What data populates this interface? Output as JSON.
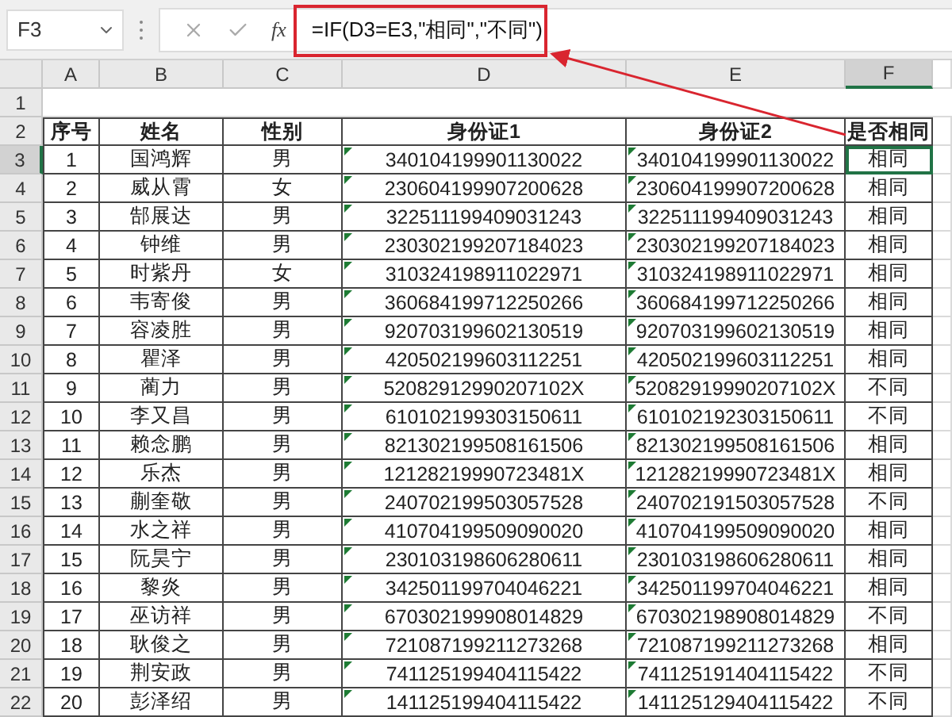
{
  "name_box": "F3",
  "function_label": "fx",
  "formula": "=IF(D3=E3,\"相同\",\"不同\")",
  "columns": [
    {
      "label": "A",
      "selected": false
    },
    {
      "label": "B",
      "selected": false
    },
    {
      "label": "C",
      "selected": false
    },
    {
      "label": "D",
      "selected": false
    },
    {
      "label": "E",
      "selected": false
    },
    {
      "label": "F",
      "selected": true
    }
  ],
  "empty_row": {
    "number": "1"
  },
  "header_row": {
    "number": "2",
    "cells": [
      "序号",
      "姓名",
      "性别",
      "身份证1",
      "身份证2",
      "是否相同"
    ]
  },
  "rows": [
    {
      "number": "3",
      "selected": true,
      "cells": [
        "1",
        "国鸿辉",
        "男",
        "340104199901130022",
        "340104199901130022",
        "相同"
      ]
    },
    {
      "number": "4",
      "selected": false,
      "cells": [
        "2",
        "威从霄",
        "女",
        "230604199907200628",
        "230604199907200628",
        "相同"
      ]
    },
    {
      "number": "5",
      "selected": false,
      "cells": [
        "3",
        "郜展达",
        "男",
        "322511199409031243",
        "322511199409031243",
        "相同"
      ]
    },
    {
      "number": "6",
      "selected": false,
      "cells": [
        "4",
        "钟维",
        "男",
        "230302199207184023",
        "230302199207184023",
        "相同"
      ]
    },
    {
      "number": "7",
      "selected": false,
      "cells": [
        "5",
        "时紫丹",
        "女",
        "310324198911022971",
        "310324198911022971",
        "相同"
      ]
    },
    {
      "number": "8",
      "selected": false,
      "cells": [
        "6",
        "韦寄俊",
        "男",
        "360684199712250266",
        "360684199712250266",
        "相同"
      ]
    },
    {
      "number": "9",
      "selected": false,
      "cells": [
        "7",
        "容凌胜",
        "男",
        "920703199602130519",
        "920703199602130519",
        "相同"
      ]
    },
    {
      "number": "10",
      "selected": false,
      "cells": [
        "8",
        "瞿泽",
        "男",
        "420502199603112251",
        "420502199603112251",
        "相同"
      ]
    },
    {
      "number": "11",
      "selected": false,
      "cells": [
        "9",
        "蔺力",
        "男",
        "52082912990207102X",
        "52082919990207102X",
        "不同"
      ]
    },
    {
      "number": "12",
      "selected": false,
      "cells": [
        "10",
        "李又昌",
        "男",
        "610102199303150611",
        "610102192303150611",
        "不同"
      ]
    },
    {
      "number": "13",
      "selected": false,
      "cells": [
        "11",
        "赖念鹏",
        "男",
        "821302199508161506",
        "821302199508161506",
        "相同"
      ]
    },
    {
      "number": "14",
      "selected": false,
      "cells": [
        "12",
        "乐杰",
        "男",
        "12128219990723481X",
        "12128219990723481X",
        "相同"
      ]
    },
    {
      "number": "15",
      "selected": false,
      "cells": [
        "13",
        "蒯奎敬",
        "男",
        "240702199503057528",
        "240702191503057528",
        "不同"
      ]
    },
    {
      "number": "16",
      "selected": false,
      "cells": [
        "14",
        "水之祥",
        "男",
        "410704199509090020",
        "410704199509090020",
        "相同"
      ]
    },
    {
      "number": "17",
      "selected": false,
      "cells": [
        "15",
        "阮昊宁",
        "男",
        "230103198606280611",
        "230103198606280611",
        "相同"
      ]
    },
    {
      "number": "18",
      "selected": false,
      "cells": [
        "16",
        "黎炎",
        "男",
        "342501199704046221",
        "342501199704046221",
        "相同"
      ]
    },
    {
      "number": "19",
      "selected": false,
      "cells": [
        "17",
        "巫访祥",
        "男",
        "670302199908014829",
        "670302198908014829",
        "不同"
      ]
    },
    {
      "number": "20",
      "selected": false,
      "cells": [
        "18",
        "耿俊之",
        "男",
        "721087199211273268",
        "721087199211273268",
        "相同"
      ]
    },
    {
      "number": "21",
      "selected": false,
      "cells": [
        "19",
        "荆安政",
        "男",
        "741125199404115422",
        "741125191404115422",
        "不同"
      ]
    },
    {
      "number": "22",
      "selected": false,
      "cells": [
        "20",
        "彭泽绍",
        "男",
        "141125199404115422",
        "141125129404115422",
        "不同"
      ]
    }
  ]
}
